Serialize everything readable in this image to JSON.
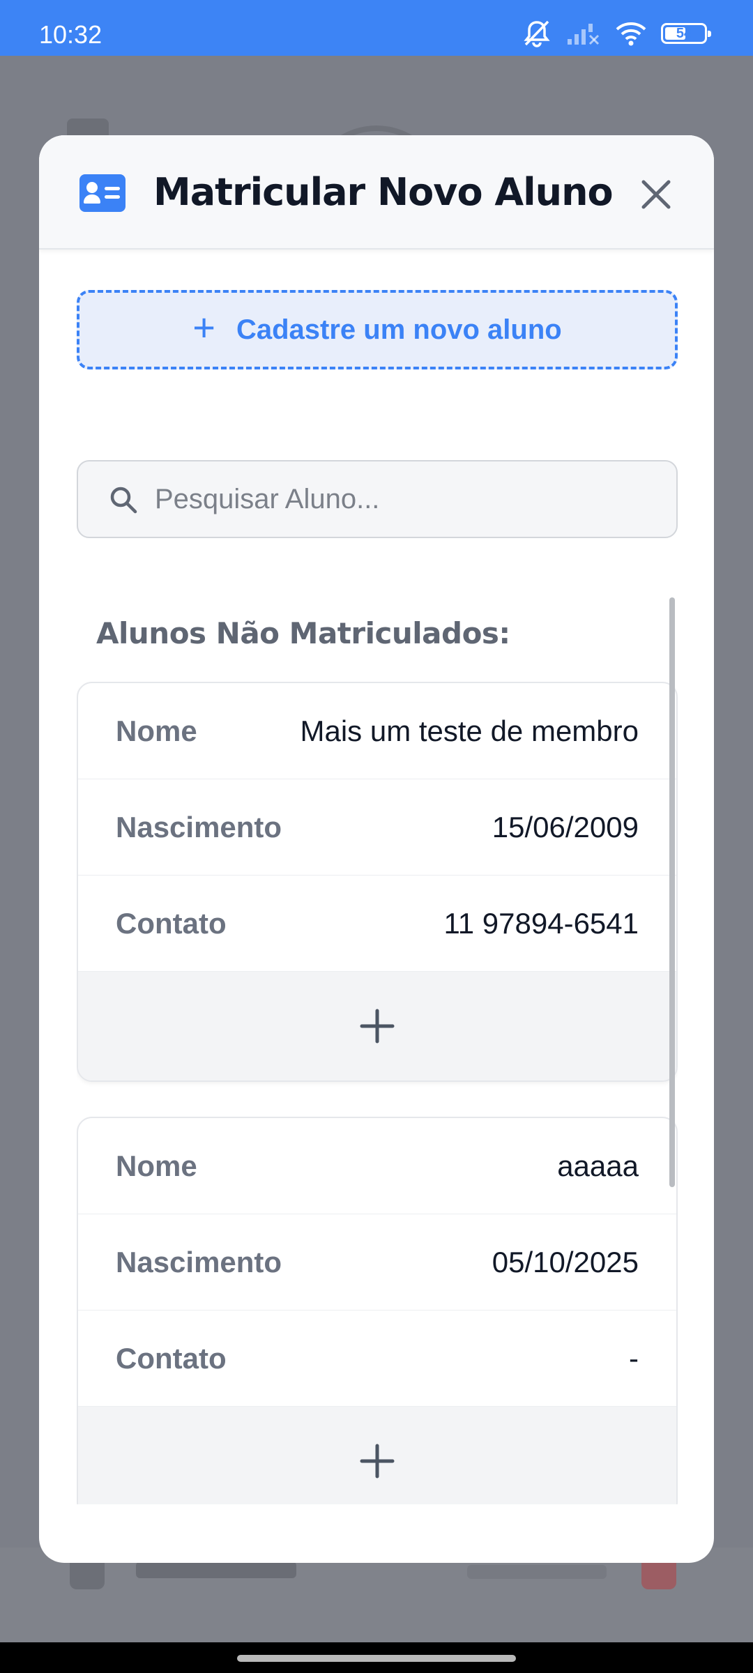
{
  "status_bar": {
    "time": "10:32",
    "battery": "54",
    "battery_level": 0.54,
    "icons": [
      "mute-icon",
      "signal-off-icon",
      "wifi-icon",
      "battery-icon"
    ]
  },
  "modal": {
    "title": "Matricular Novo Aluno",
    "header_icon": "id-card-icon",
    "new_student_label": "Cadastre um novo aluno",
    "search": {
      "placeholder": "Pesquisar Aluno...",
      "value": ""
    },
    "section_label": "Alunos Não Matriculados:",
    "students": [
      {
        "fields": [
          {
            "label": "Nome",
            "value": "Mais um teste de membro"
          },
          {
            "label": "Nascimento",
            "value": "15/06/2009"
          },
          {
            "label": "Contato",
            "value": "11 97894-6541"
          }
        ]
      },
      {
        "fields": [
          {
            "label": "Nome",
            "value": "aaaaa"
          },
          {
            "label": "Nascimento",
            "value": "05/10/2025"
          },
          {
            "label": "Contato",
            "value": "-"
          }
        ]
      }
    ]
  },
  "colors": {
    "status_bar": "#3d84f5",
    "accent": "#3b82f6",
    "title": "#111827",
    "label": "#6b7280"
  }
}
